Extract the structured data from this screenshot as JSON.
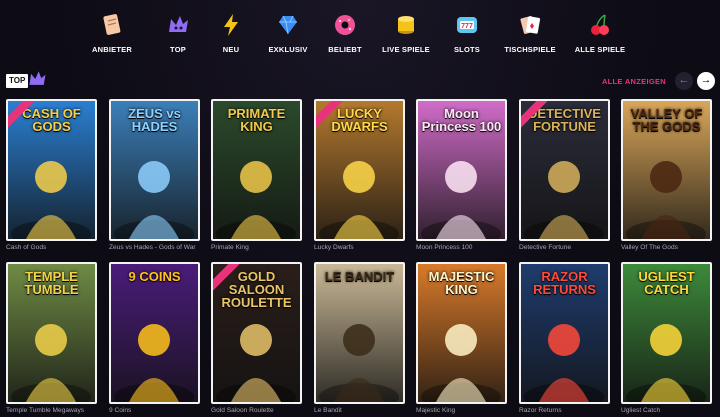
{
  "nav": {
    "items": [
      {
        "label": "ANBIETER",
        "icon": "scroll-icon",
        "color": "#f5c9a5"
      },
      {
        "label": "TOP",
        "icon": "crown-icon",
        "color": "#8e6cf3"
      },
      {
        "label": "NEU",
        "icon": "lightning-icon",
        "color": "#f2c514"
      },
      {
        "label": "EXKLUSIV",
        "icon": "diamond-icon",
        "color": "#3a8df5"
      },
      {
        "label": "BELIEBT",
        "icon": "donut-icon",
        "color": "#f0529a"
      },
      {
        "label": "LIVE SPIELE",
        "icon": "coins-icon",
        "color": "#f5c21a"
      },
      {
        "label": "SLOTS",
        "icon": "slot-machine-icon",
        "color": "#5dc7f3"
      },
      {
        "label": "TISCHSPIELE",
        "icon": "playing-cards-icon",
        "color": "#f3c9b0"
      },
      {
        "label": "ALLE SPIELE",
        "icon": "cherries-icon",
        "color": "#e8233e"
      }
    ]
  },
  "section": {
    "badge": "TOP",
    "show_all": "ALLE ANZEIGEN",
    "prev_icon": "arrow-left-icon",
    "next_icon": "arrow-right-icon"
  },
  "games": [
    {
      "title": "Cash of Gods",
      "art": "CASH OF GODS",
      "bg": "#2a7fd1",
      "fg": "#f7d04a",
      "exclusive": true
    },
    {
      "title": "Zeus vs Hades - Gods of War",
      "art": "ZEUS vs HADES",
      "bg": "#3b7fb9",
      "fg": "#8fd0ff",
      "exclusive": false
    },
    {
      "title": "Primate King",
      "art": "PRIMATE KING",
      "bg": "#2b4a2b",
      "fg": "#f2c94a",
      "exclusive": false
    },
    {
      "title": "Lucky Dwarfs",
      "art": "LUCKY DWARFS",
      "bg": "#b4792e",
      "fg": "#ffd94a",
      "exclusive": true
    },
    {
      "title": "Moon Princess 100",
      "art": "Moon Princess 100",
      "bg": "#d06cc8",
      "fg": "#ffe7f7",
      "exclusive": false
    },
    {
      "title": "Detective Fortune",
      "art": "DETECTIVE FORTUNE",
      "bg": "#2b2c3a",
      "fg": "#d8b25a",
      "exclusive": true
    },
    {
      "title": "Valley Of The Gods",
      "art": "VALLEY OF THE GODS",
      "bg": "#d9a65a",
      "fg": "#4a2510",
      "exclusive": false
    },
    {
      "title": "Temple Tumble Megaways",
      "art": "TEMPLE TUMBLE",
      "bg": "#6f8b45",
      "fg": "#f2d24a",
      "exclusive": false
    },
    {
      "title": "9 Coins",
      "art": "9 COINS",
      "bg": "#4a1c7a",
      "fg": "#ffc31a",
      "exclusive": false
    },
    {
      "title": "Gold Saloon Roulette",
      "art": "GOLD SALOON ROULETTE",
      "bg": "#2a1e1a",
      "fg": "#e9c56a",
      "exclusive": true
    },
    {
      "title": "Le Bandit",
      "art": "LE BANDIT",
      "bg": "#c9b896",
      "fg": "#3a2a18",
      "exclusive": false
    },
    {
      "title": "Majestic King",
      "art": "MAJESTIC KING",
      "bg": "#d97a2a",
      "fg": "#fff4c8",
      "exclusive": false
    },
    {
      "title": "Razor Returns",
      "art": "RAZOR RETURNS",
      "bg": "#1f3c6e",
      "fg": "#ff4a3a",
      "exclusive": false
    },
    {
      "title": "Ugliest Catch",
      "art": "UGLIEST CATCH",
      "bg": "#3d8a3a",
      "fg": "#ffd93a",
      "exclusive": false
    }
  ],
  "colors": {
    "accent": "#e8337a",
    "background": "#0d0b14"
  }
}
